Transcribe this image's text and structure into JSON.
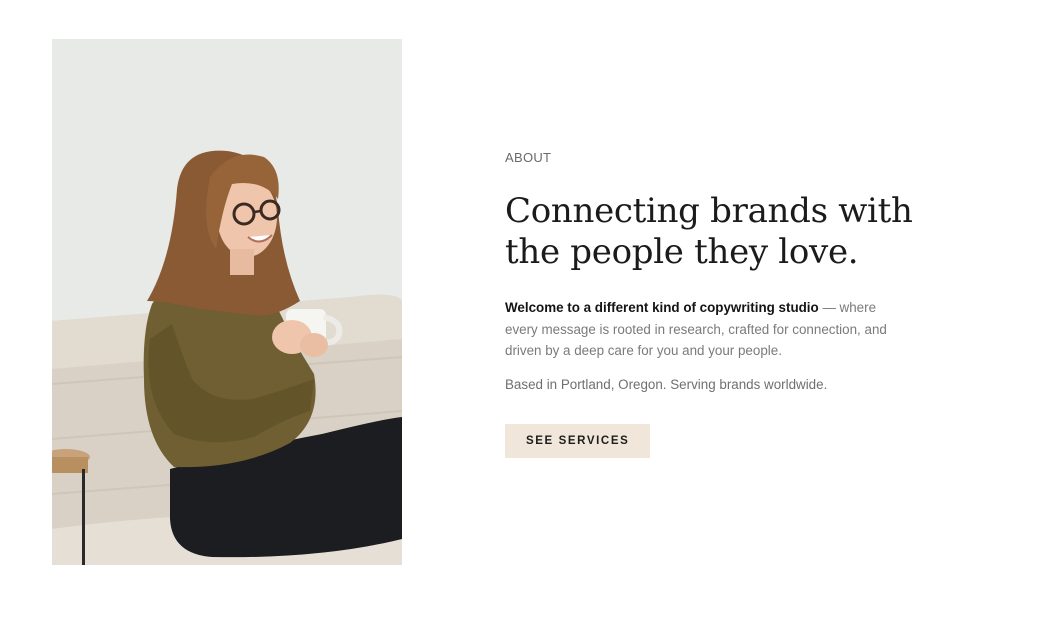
{
  "about": {
    "eyebrow": "ABOUT",
    "headline": "Connecting brands with the people they love.",
    "intro_bold": "Welcome to a different kind of copywriting studio",
    "intro_rest": " — where every message is rooted in research, crafted for connection, and driven by a deep care for you and your people.",
    "location": "Based in Portland, Oregon. Serving brands worldwide.",
    "cta_label": "SEE SERVICES"
  },
  "photo": {
    "subject": "woman-with-coffee-mug-on-sofa"
  },
  "colors": {
    "cta_background": "#f0e6da",
    "headline": "#1b1b1b",
    "body_text": "#7a7a7a"
  }
}
